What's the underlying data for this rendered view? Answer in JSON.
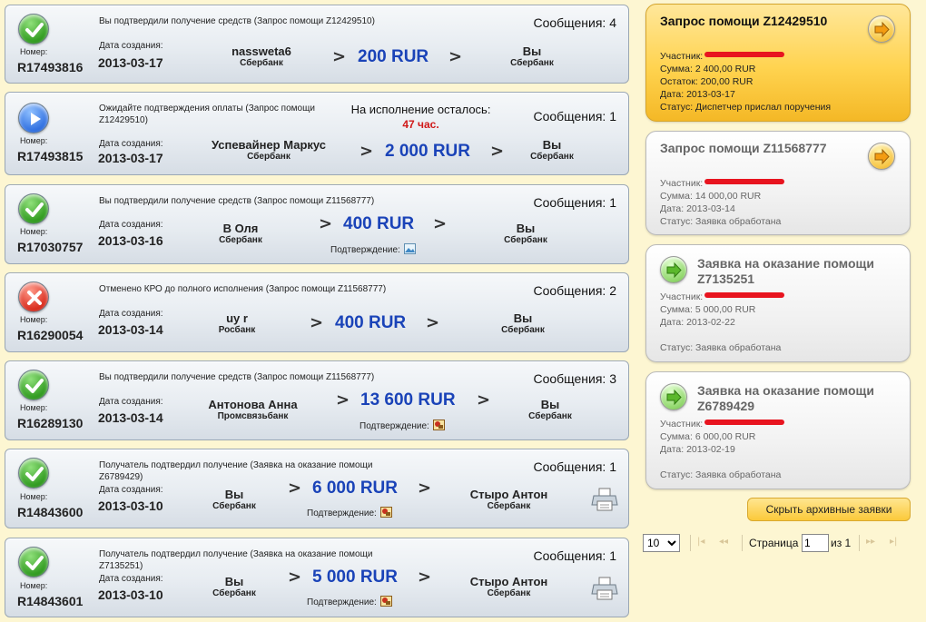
{
  "transactions": [
    {
      "status_icon": "check-icon",
      "description": "Вы подтвердили получение средств (Запрос помощи Z12429510)",
      "messages": "Сообщения: 4",
      "number_label": "Номер:",
      "number": "R17493816",
      "date_label": "Дата создания:",
      "date": "2013-03-17",
      "from_name": "nassweta6",
      "from_bank": "Сбербанк",
      "amount": "200 RUR",
      "to_name": "Вы",
      "to_bank": "Сбербанк"
    },
    {
      "status_icon": "play-icon",
      "description": "Ожидайте подтверждения оплаты (Запрос помощи Z12429510)",
      "remaining_label": "На исполнение осталось:",
      "remaining_hours": "47 час.",
      "messages": "Сообщения: 1",
      "number_label": "Номер:",
      "number": "R17493815",
      "date_label": "Дата создания:",
      "date": "2013-03-17",
      "from_name": "Успевайнер Маркус",
      "from_bank": "Сбербанк",
      "amount": "2 000 RUR",
      "to_name": "Вы",
      "to_bank": "Сбербанк"
    },
    {
      "status_icon": "check-icon",
      "description": "Вы подтвердили получение средств (Запрос помощи Z11568777)",
      "messages": "Сообщения: 1",
      "number_label": "Номер:",
      "number": "R17030757",
      "date_label": "Дата создания:",
      "date": "2013-03-16",
      "from_name": "В Оля",
      "from_bank": "Сбербанк",
      "amount": "400 RUR",
      "confirm_label": "Подтверждение:",
      "to_name": "Вы",
      "to_bank": "Сбербанк"
    },
    {
      "status_icon": "cancel-icon",
      "description": "Отменено КРО до полного исполнения (Запрос помощи Z11568777)",
      "messages": "Сообщения: 2",
      "number_label": "Номер:",
      "number": "R16290054",
      "date_label": "Дата создания:",
      "date": "2013-03-14",
      "from_name": "uy r",
      "from_bank": "Росбанк",
      "amount": "400 RUR",
      "to_name": "Вы",
      "to_bank": "Сбербанк"
    },
    {
      "status_icon": "check-icon",
      "description": "Вы подтвердили получение средств (Запрос помощи Z11568777)",
      "messages": "Сообщения: 3",
      "number_label": "Номер:",
      "number": "R16289130",
      "date_label": "Дата создания:",
      "date": "2013-03-14",
      "from_name": "Антонова Анна",
      "from_bank": "Промсвязьбанк",
      "amount": "13 600 RUR",
      "confirm_label": "Подтверждение:",
      "to_name": "Вы",
      "to_bank": "Сбербанк"
    },
    {
      "status_icon": "check-icon",
      "description": "Получатель подтвердил получение (Заявка на оказание помощи Z6789429)",
      "messages": "Сообщения: 1",
      "number_label": "Номер:",
      "number": "R14843600",
      "date_label": "Дата создания:",
      "date": "2013-03-10",
      "from_name": "Вы",
      "from_bank": "Сбербанк",
      "amount": "6 000 RUR",
      "confirm_label": "Подтверждение:",
      "to_name": "Стыро Антон",
      "to_bank": "Сбербанк"
    },
    {
      "status_icon": "check-icon",
      "description": "Получатель подтвердил получение (Заявка на оказание помощи Z7135251)",
      "messages": "Сообщения: 1",
      "number_label": "Номер:",
      "number": "R14843601",
      "date_label": "Дата создания:",
      "date": "2013-03-10",
      "from_name": "Вы",
      "from_bank": "Сбербанк",
      "amount": "5 000 RUR",
      "confirm_label": "Подтверждение:",
      "to_name": "Стыро Антон",
      "to_bank": "Сбербанк"
    }
  ],
  "arrow_glyph": ">",
  "requests": [
    {
      "title": "Запрос помощи Z12429510",
      "participant_label": "Участник:",
      "sum": "Сумма: 2 400,00 RUR",
      "remainder": "Остаток: 200,00 RUR",
      "date": "Дата: 2013-03-17",
      "status": "Статус: Диспетчер прислал поручения"
    },
    {
      "title": "Запрос помощи Z11568777",
      "participant_label": "Участник:",
      "sum": "Сумма: 14 000,00 RUR",
      "date": "Дата: 2013-03-14",
      "status": "Статус: Заявка обработана"
    },
    {
      "title": "Заявка на оказание помощи Z7135251",
      "participant_label": "Участник:",
      "sum": "Сумма: 5 000,00 RUR",
      "date": "Дата: 2013-02-22",
      "status": "Статус: Заявка обработана"
    },
    {
      "title": "Заявка на оказание помощи Z6789429",
      "participant_label": "Участник:",
      "sum": "Сумма: 6 000,00 RUR",
      "date": "Дата: 2013-02-19",
      "status": "Статус: Заявка обработана"
    }
  ],
  "hide_archive_button": "Скрыть архивные заявки",
  "pager": {
    "per_page": "10",
    "page_label": "Страница",
    "current_page": "1",
    "of_label": "из 1"
  },
  "colors": {
    "amount": "#1a43b8",
    "hours": "#d01818",
    "active_request": "#ffd34f",
    "redaction": "#e8141f"
  }
}
